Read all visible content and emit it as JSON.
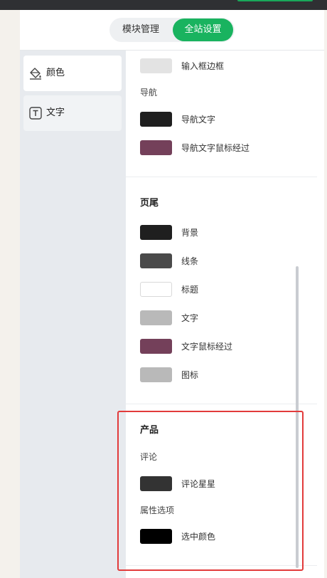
{
  "header": {
    "tabs": [
      {
        "label": "模块管理"
      },
      {
        "label": "全站设置"
      }
    ]
  },
  "sidebar": {
    "items": [
      {
        "label": "颜色",
        "icon": "paint-bucket-icon"
      },
      {
        "label": "文字",
        "icon": "text-t-icon"
      }
    ]
  },
  "content": {
    "input_border": {
      "label": "输入框边框",
      "color": "#e3e3e3"
    },
    "nav": {
      "title": "导航",
      "items": [
        {
          "label": "导航文字",
          "color": "#1f1f1f"
        },
        {
          "label": "导航文字鼠标经过",
          "color": "#74405a"
        }
      ]
    },
    "footer": {
      "title": "页尾",
      "items": [
        {
          "label": "背景",
          "color": "#1f1f1f"
        },
        {
          "label": "线条",
          "color": "#4a4a4a"
        },
        {
          "label": "标题",
          "color": "#ffffff"
        },
        {
          "label": "文字",
          "color": "#b9b9b9"
        },
        {
          "label": "文字鼠标经过",
          "color": "#74405a"
        },
        {
          "label": "图标",
          "color": "#b9b9b9"
        }
      ]
    },
    "product": {
      "title": "产品",
      "review_title": "评论",
      "review_stars": {
        "label": "评论星星",
        "color": "#333333"
      },
      "attr_title": "属性选项",
      "selected_color": {
        "label": "选中颜色",
        "color": "#000000"
      }
    }
  },
  "colors": {
    "accent": "#19b35f",
    "highlight": "#e23b3b"
  }
}
